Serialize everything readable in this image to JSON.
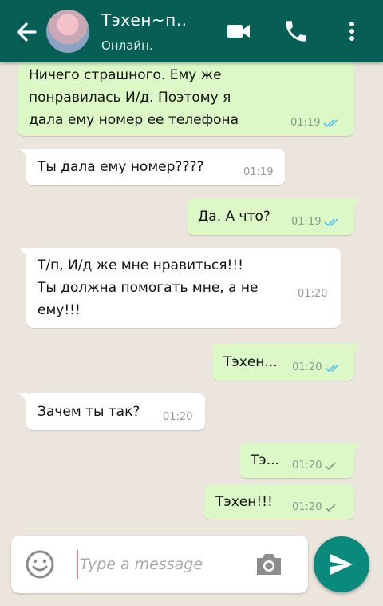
{
  "header": {
    "contact_name": "Тэхен~п..",
    "status": "Онлайн.",
    "icons": [
      "back-arrow-icon",
      "video-call-icon",
      "phone-icon",
      "more-vert-icon"
    ],
    "background_color": "#075e54"
  },
  "messages": [
    {
      "direction": "out",
      "lines": [
        "Ничего страшного. Ему же",
        "понравилась И/д. Поэтому я",
        "дала ему номер ее телефона"
      ],
      "time": "01:19",
      "status": "read"
    },
    {
      "direction": "in",
      "lines": [
        "Ты дала ему номер????"
      ],
      "time": "01:19"
    },
    {
      "direction": "out",
      "lines": [
        "Да. А что?"
      ],
      "time": "01:19",
      "status": "read"
    },
    {
      "direction": "in",
      "lines": [
        "Т/п, И/д же мне нравиться!!!",
        "Ты должна помогать мне, а не",
        "ему!!!"
      ],
      "time": "01:20"
    },
    {
      "direction": "out",
      "lines": [
        "Тэхен..."
      ],
      "time": "01:20",
      "status": "read"
    },
    {
      "direction": "in",
      "lines": [
        "Зачем ты так?"
      ],
      "time": "01:20"
    },
    {
      "direction": "out",
      "lines": [
        "Тэ..."
      ],
      "time": "01:20",
      "status": "sent"
    },
    {
      "direction": "out",
      "lines": [
        "Тэхен!!!"
      ],
      "time": "01:20",
      "status": "sent"
    }
  ],
  "composer": {
    "placeholder": "Type a message",
    "value": ""
  },
  "colors": {
    "outgoing_bubble": "#dcf8c6",
    "incoming_bubble": "#ffffff",
    "read_tick": "#4fc3f7",
    "sent_tick": "#8a9a8a",
    "send_button": "#0a8a7c"
  }
}
